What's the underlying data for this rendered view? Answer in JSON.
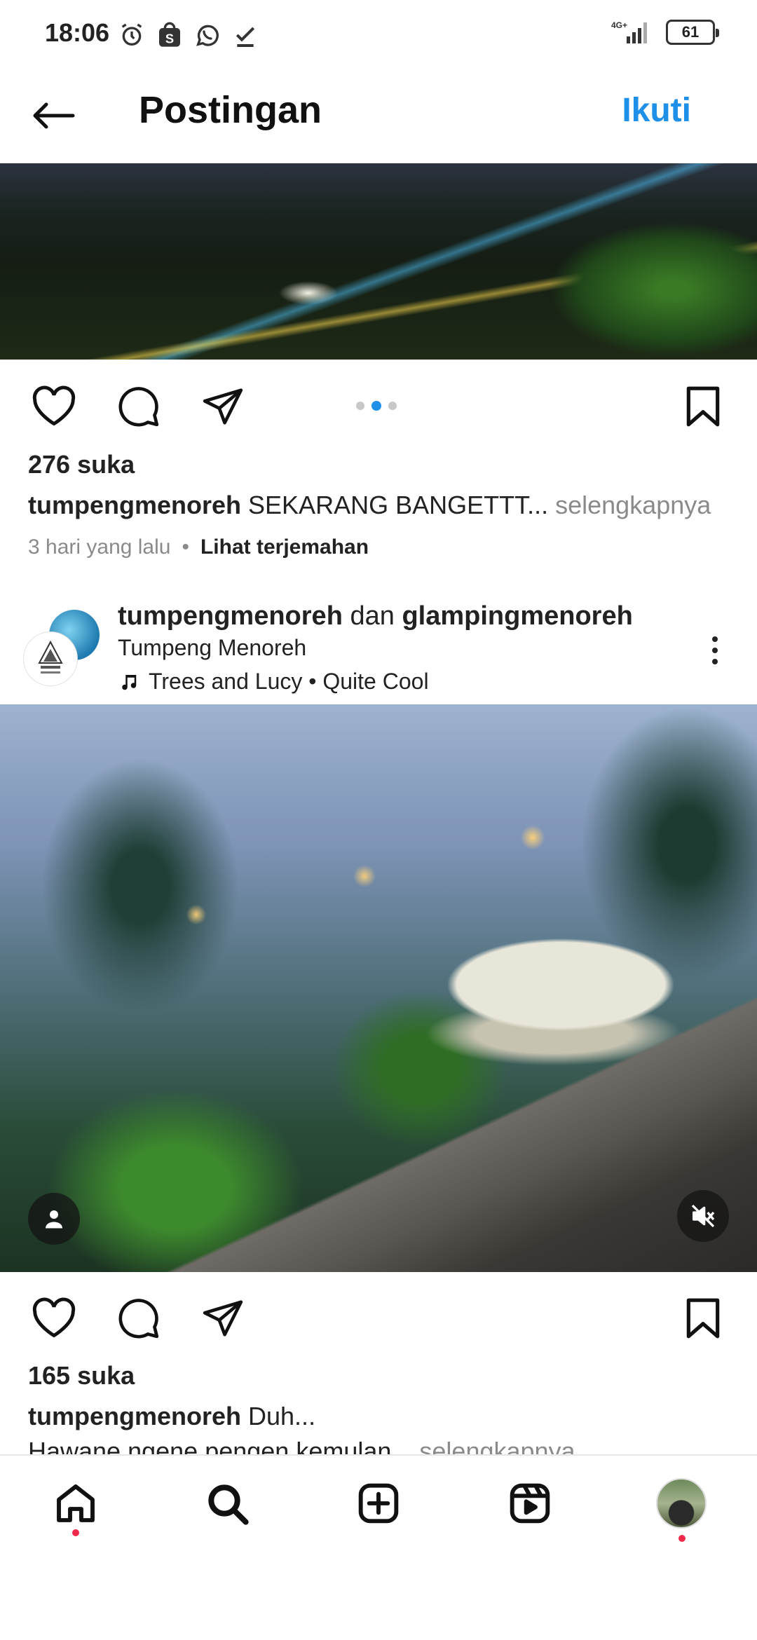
{
  "status_bar": {
    "time": "18:06",
    "network": "4G+",
    "battery": "61",
    "icons": [
      "alarm-icon",
      "shop-icon",
      "whatsapp-icon",
      "check-icon",
      "signal-icon",
      "battery-icon"
    ]
  },
  "header": {
    "title": "Postingan",
    "follow_label": "Ikuti"
  },
  "post1": {
    "likes": "276 suka",
    "username": "tumpengmenoreh",
    "caption": " SEKARANG BANGETTT...",
    "more": " selengkapnya",
    "time_ago": "3 hari yang lalu",
    "separator": "•",
    "translate": "Lihat terjemahan",
    "carousel_total": 3,
    "carousel_active": 2
  },
  "post2": {
    "user_primary": "tumpengmenoreh",
    "joiner": " dan ",
    "user_secondary": "glampingmenoreh",
    "location": "Tumpeng Menoreh",
    "music": "Trees and Lucy • Quite Cool",
    "likes": "165 suka",
    "username": "tumpengmenoreh",
    "caption": " Duh...",
    "caption_line2": "Hawane ngene pengen kemulan...",
    "more": " selengkapnya"
  },
  "colors": {
    "accent": "#1e90e8",
    "notification": "#f02849",
    "muted_text": "#8a8a8a"
  },
  "nav": [
    "home-icon",
    "search-icon",
    "add-post-icon",
    "reels-icon",
    "profile-avatar"
  ]
}
